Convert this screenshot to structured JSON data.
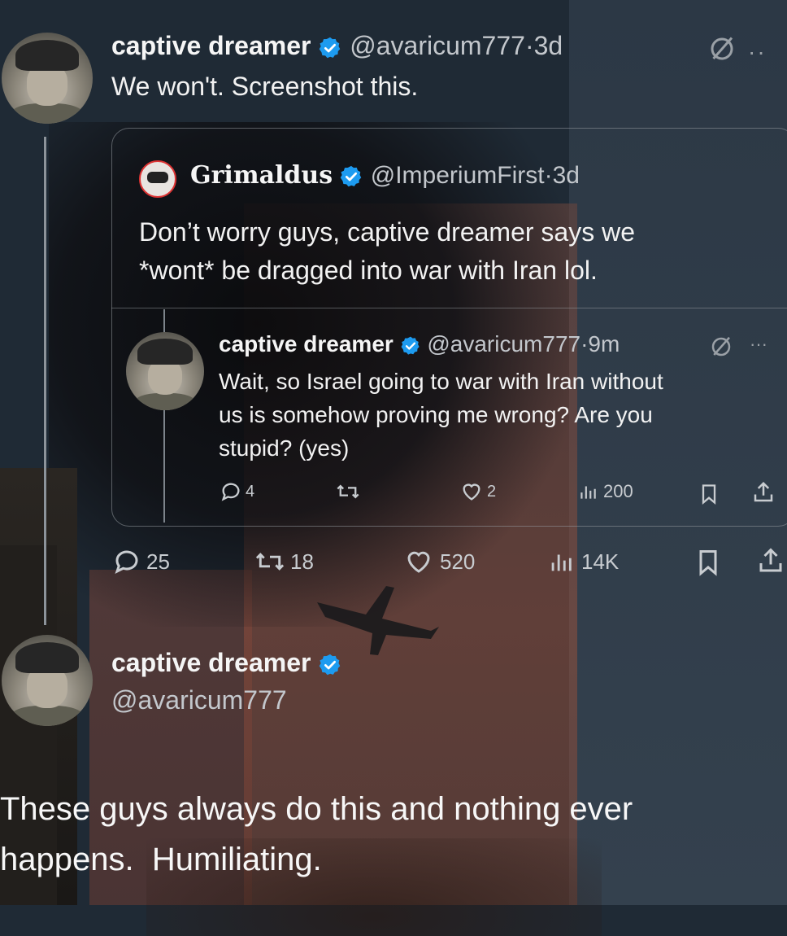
{
  "tweet_main": {
    "name": "captive dreamer",
    "handle": "@avaricum777",
    "time": "3d",
    "sep": "·",
    "text": "We won't. Screenshot this.",
    "stats": {
      "replies": "25",
      "retweets": "18",
      "likes": "520",
      "views": "14K"
    }
  },
  "quote": {
    "name": "Grimaldus",
    "handle": "@ImperiumFirst",
    "time": "3d",
    "sep": "·",
    "text_line1": "Don’t worry guys, captive dreamer says we",
    "text_line2": "*wont* be dragged into war with Iran lol."
  },
  "reply": {
    "name": "captive dreamer",
    "handle": "@avaricum777",
    "time": "9m",
    "sep": "·",
    "text_line1": "Wait, so Israel going to war with Iran without",
    "text_line2": "us is somehow proving me wrong? Are you",
    "text_line3": "stupid? (yes)",
    "stats": {
      "replies": "4",
      "retweets": "",
      "likes": "2",
      "views": "200"
    }
  },
  "profile": {
    "name": "captive dreamer",
    "handle": "@avaricum777"
  },
  "caption": {
    "line1": "These guys always do this and nothing ever",
    "line2": "happens.  Humiliating."
  },
  "colors": {
    "verified": "#1d9bf0",
    "text": "#f2f2f2",
    "muted": "#c3c7cc"
  }
}
